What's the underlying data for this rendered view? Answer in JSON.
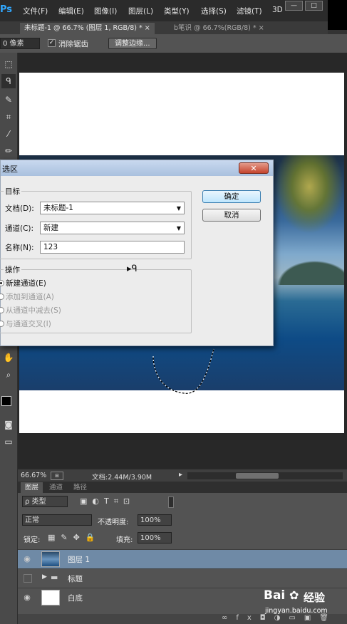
{
  "app": {
    "logo": "Ps"
  },
  "menu": [
    "文件(F)",
    "编辑(E)",
    "图像(I)",
    "图层(L)",
    "类型(Y)",
    "选择(S)",
    "滤镜(T)",
    "3D"
  ],
  "window_controls": {
    "minimize": "—",
    "restore": "□"
  },
  "tabs": [
    {
      "label": "未标题-1 @ 66.7% (图层 1, RGB/8) *",
      "close": "×",
      "active": true
    },
    {
      "label": "b笔识 @ 66.7%(RGB/8) *",
      "close": "×",
      "active": false
    }
  ],
  "options": {
    "feather_value": "0 像素",
    "antialias_label": "消除锯齿",
    "antialias_checked": true,
    "refine_edge_button": "调整边缘..."
  },
  "tools": [
    "marquee-icon",
    "lasso-icon",
    "brush-icon",
    "crop-icon",
    "eyedropper-icon",
    "pencil-icon",
    "hand-icon",
    "zoom-icon"
  ],
  "status": {
    "zoom": "66.67%",
    "doc_info": "文档:2.44M/3.90M"
  },
  "layers_panel": {
    "tabs": [
      "图层",
      "通道",
      "路径"
    ],
    "filter_kind": "ρ 类型",
    "blend_mode": "正常",
    "opacity_label": "不透明度:",
    "opacity_value": "100%",
    "lock_label": "锁定:",
    "fill_label": "填充:",
    "fill_value": "100%",
    "layers": [
      {
        "name": "图层 1",
        "visible": true,
        "selected": true
      },
      {
        "name": "标题",
        "visible": false,
        "selected": false,
        "group": true
      },
      {
        "name": "白底",
        "visible": true,
        "selected": false
      }
    ]
  },
  "dialog": {
    "title": "选区",
    "close": "✕",
    "target_group": "目标",
    "document_label": "文档(D):",
    "document_value": "未标题-1",
    "channel_label": "通道(C):",
    "channel_value": "新建",
    "name_label": "名称(N):",
    "name_value": "123",
    "operation_group": "操作",
    "operations": [
      {
        "label": "新建通道(E)",
        "selected": true,
        "enabled": true
      },
      {
        "label": "添加到通道(A)",
        "selected": false,
        "enabled": false
      },
      {
        "label": "从通道中减去(S)",
        "selected": false,
        "enabled": false
      },
      {
        "label": "与通道交叉(I)",
        "selected": false,
        "enabled": false
      }
    ],
    "ok_button": "确定",
    "cancel_button": "取消"
  },
  "watermark": {
    "brand": "Bai",
    "brand2": "经验",
    "url": "jingyan.baidu.com"
  }
}
